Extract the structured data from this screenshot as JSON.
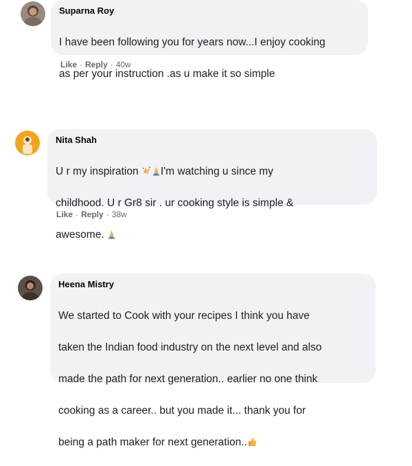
{
  "comments": [
    {
      "name": "Suparna Roy",
      "lines": [
        "I have been following you for years now...I enjoy cooking",
        "as per your instruction .as u make it so simple"
      ],
      "like": "Like",
      "reply": "Reply",
      "time": "40w"
    },
    {
      "name": "Nita Shah",
      "line1_a": "U r my inspiration ",
      "line1_b": "I'm watching u since my",
      "line2": "childhood. U r Gr8 sir . ur cooking style is simple &",
      "line3": "awesome.",
      "like": "Like",
      "reply": "Reply",
      "time": "38w"
    },
    {
      "name": "Heena Mistry",
      "lines": [
        "We started to Cook with your recipes I think you have",
        "taken the Indian food industry on the next level and also",
        "made the path for next generation.. earlier no one think",
        "cooking as a career.. but you made it... thank you for"
      ],
      "last_line": "being a path maker for next generation.."
    }
  ],
  "colors": {
    "bubble": "#f0f2f5",
    "meta": "#65676b"
  },
  "icons": [
    "clapping-hands-icon",
    "folded-hands-icon",
    "thumbs-up-icon"
  ]
}
